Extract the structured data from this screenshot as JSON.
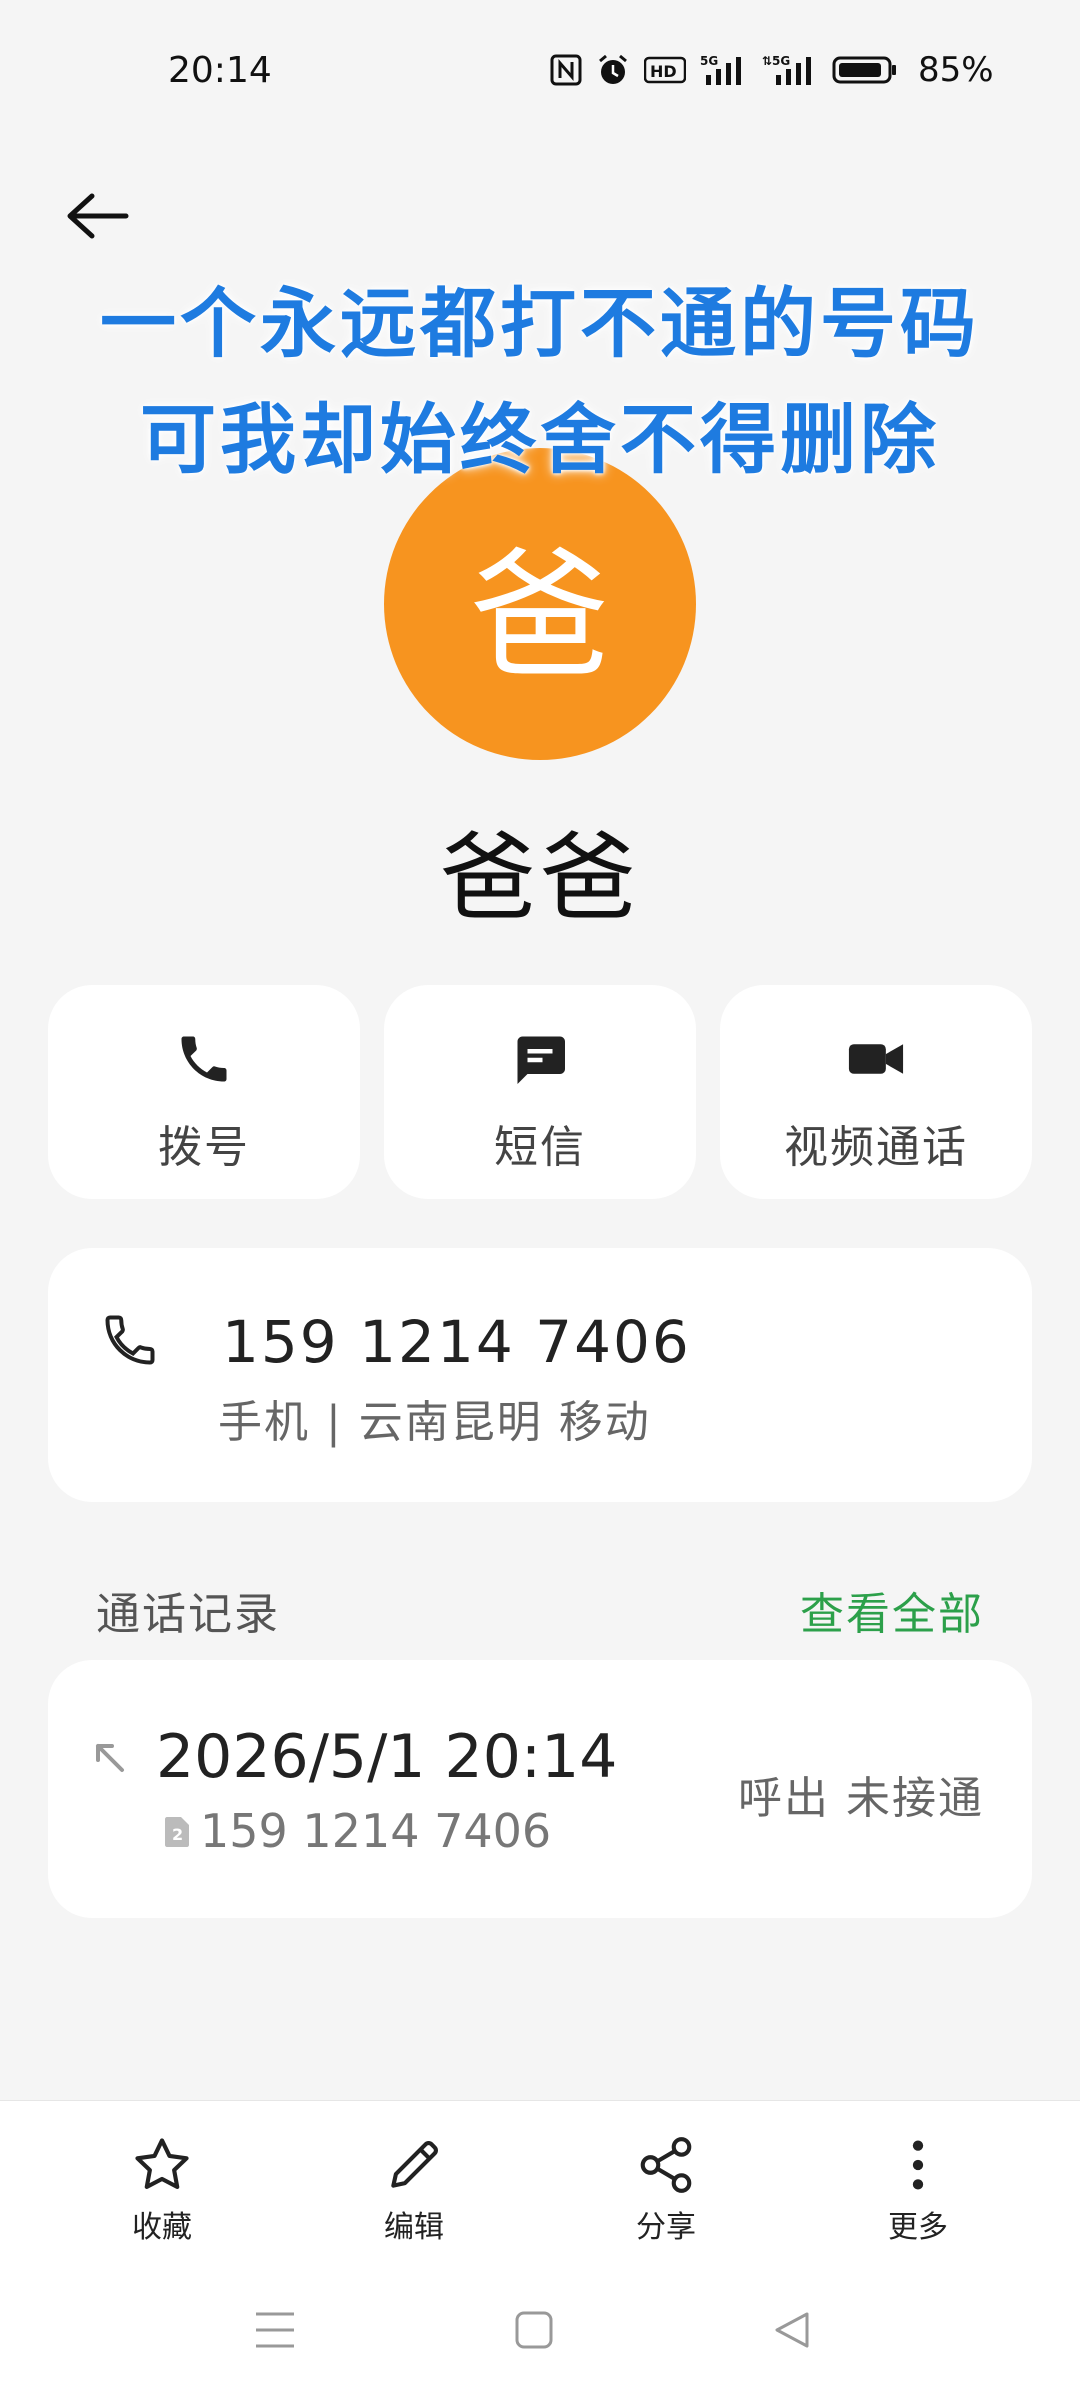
{
  "status_bar": {
    "time": "20:14",
    "battery": "85%",
    "icons": [
      "nfc-icon",
      "alarm-icon",
      "hd-icon",
      "signal-5g-icon",
      "signal-5g-icon",
      "battery-icon"
    ]
  },
  "overlay_text": {
    "line1": "一个永远都打不通的号码",
    "line2": "可我却始终舍不得删除"
  },
  "contact": {
    "avatar_char": "爸",
    "avatar_color": "#f7941f",
    "name": "爸爸"
  },
  "actions": [
    {
      "label": "拨号",
      "icon": "phone-icon"
    },
    {
      "label": "短信",
      "icon": "message-icon"
    },
    {
      "label": "视频通话",
      "icon": "video-icon"
    }
  ],
  "phone": {
    "number": "159 1214 7406",
    "detail": "手机 | 云南昆明 移动"
  },
  "call_log": {
    "title": "通话记录",
    "view_all": "查看全部",
    "view_all_color": "#2ca04a",
    "entries": [
      {
        "datetime": "2026/5/1 20:14",
        "sim": "2",
        "number": "159 1214 7406",
        "status": "呼出 未接通"
      }
    ]
  },
  "toolbar": {
    "favorite": "收藏",
    "edit": "编辑",
    "share": "分享",
    "more": "更多"
  }
}
